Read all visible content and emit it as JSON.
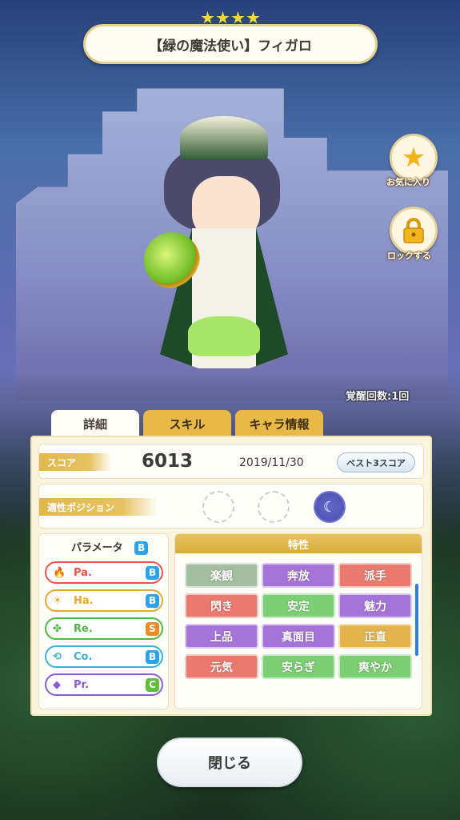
{
  "header": {
    "title": "【緑の魔法使い】フィガロ",
    "rarity_stars": 4
  },
  "side_buttons": {
    "favorite_label": "お気に入り",
    "lock_label": "ロックする"
  },
  "awakening": "覚醒回数:1回",
  "tabs": [
    {
      "label": "詳細",
      "active": true
    },
    {
      "label": "スキル",
      "active": false
    },
    {
      "label": "キャラ情報",
      "active": false
    }
  ],
  "score": {
    "label": "スコア",
    "value": "6013",
    "date": "2019/11/30",
    "best_button": "ベスト3スコア"
  },
  "position": {
    "label": "適性ポジション"
  },
  "parameters": {
    "title": "パラメータ",
    "overall_grade": "B",
    "items": [
      {
        "label": "Pa.",
        "grade": "B",
        "color": "#e8534b"
      },
      {
        "label": "Ha.",
        "grade": "B",
        "color": "#e8a628"
      },
      {
        "label": "Re.",
        "grade": "S",
        "color": "#4fb64a"
      },
      {
        "label": "Co.",
        "grade": "B",
        "color": "#39b1d6"
      },
      {
        "label": "Pr.",
        "grade": "C",
        "color": "#8a5bd6"
      }
    ]
  },
  "traits": {
    "title": "特性",
    "items": [
      {
        "label": "楽観"
      },
      {
        "label": "奔放"
      },
      {
        "label": "派手"
      },
      {
        "label": "閃き"
      },
      {
        "label": "安定"
      },
      {
        "label": "魅力"
      },
      {
        "label": "上品"
      },
      {
        "label": "真面目"
      },
      {
        "label": "正直"
      },
      {
        "label": "元気"
      },
      {
        "label": "安らぎ"
      },
      {
        "label": "爽やか"
      }
    ]
  },
  "close_button": "閉じる"
}
